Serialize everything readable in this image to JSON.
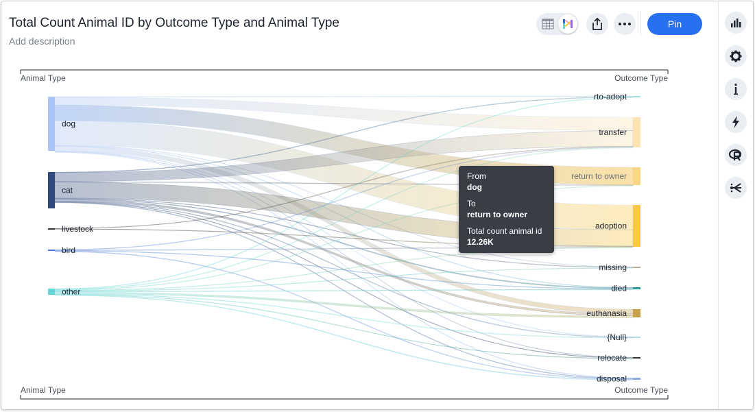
{
  "header": {
    "title": "Total Count Animal ID by Outcome Type and Animal Type",
    "description_placeholder": "Add description",
    "pin_label": "Pin"
  },
  "colors": {
    "accent": "#2770ef",
    "dog": "#a9c4f5",
    "cat": "#2f4a7d",
    "livestock": "#333333",
    "bird": "#4a78d6",
    "other": "#5fd6d4",
    "rto_adopt": "#9fe0dd",
    "transfer": "#fbe3b2",
    "return_to_owner": "#f8d683",
    "adoption": "#f8c844",
    "missing": "#b9b19a",
    "died": "#2a9d97",
    "euthanasia": "#c9a04a",
    "null": "#b8dce6",
    "relocate": "#333333",
    "disposal": "#8aa8df"
  },
  "toolbar_icons": [
    "table-icon",
    "chart-icon",
    "share-icon",
    "more-icon"
  ],
  "sidebar_icons": [
    "chart-type-icon",
    "settings-icon",
    "info-icon",
    "lightning-icon",
    "r-analysis-icon",
    "spotter-icon"
  ],
  "chart_data": {
    "type": "sankey",
    "title": "Total Count Animal ID by Outcome Type and Animal Type",
    "left_axis_label": "Animal Type",
    "right_axis_label": "Outcome Type",
    "sources": [
      "dog",
      "cat",
      "livestock",
      "bird",
      "other"
    ],
    "targets": [
      "rto-adopt",
      "transfer",
      "return to owner",
      "adoption",
      "missing",
      "died",
      "euthanasia",
      "{Null}",
      "relocate",
      "disposal"
    ],
    "source_totals": [
      42.0,
      28.5,
      0.3,
      0.6,
      4.8
    ],
    "target_totals": [
      0.6,
      13.5,
      12.3,
      32.0,
      0.3,
      1.1,
      6.1,
      0.8,
      0.3,
      0.7
    ],
    "links": [
      {
        "from": "dog",
        "to": "rto-adopt",
        "value": 0.3
      },
      {
        "from": "dog",
        "to": "transfer",
        "value": 6.0
      },
      {
        "from": "dog",
        "to": "return to owner",
        "value": 12.26
      },
      {
        "from": "dog",
        "to": "adoption",
        "value": 19.0
      },
      {
        "from": "dog",
        "to": "missing",
        "value": 0.1
      },
      {
        "from": "dog",
        "to": "died",
        "value": 0.3
      },
      {
        "from": "dog",
        "to": "euthanasia",
        "value": 3.5
      },
      {
        "from": "dog",
        "to": "{Null}",
        "value": 0.2
      },
      {
        "from": "dog",
        "to": "relocate",
        "value": 0.05
      },
      {
        "from": "dog",
        "to": "disposal",
        "value": 0.2
      },
      {
        "from": "cat",
        "to": "rto-adopt",
        "value": 0.2
      },
      {
        "from": "cat",
        "to": "transfer",
        "value": 7.0
      },
      {
        "from": "cat",
        "to": "return to owner",
        "value": 0.1
      },
      {
        "from": "cat",
        "to": "adoption",
        "value": 12.5
      },
      {
        "from": "cat",
        "to": "missing",
        "value": 0.1
      },
      {
        "from": "cat",
        "to": "died",
        "value": 0.5
      },
      {
        "from": "cat",
        "to": "euthanasia",
        "value": 1.5
      },
      {
        "from": "cat",
        "to": "{Null}",
        "value": 0.2
      },
      {
        "from": "cat",
        "to": "relocate",
        "value": 0.05
      },
      {
        "from": "cat",
        "to": "disposal",
        "value": 0.2
      },
      {
        "from": "livestock",
        "to": "adoption",
        "value": 0.1
      },
      {
        "from": "livestock",
        "to": "transfer",
        "value": 0.1
      },
      {
        "from": "bird",
        "to": "adoption",
        "value": 0.2
      },
      {
        "from": "bird",
        "to": "transfer",
        "value": 0.2
      },
      {
        "from": "bird",
        "to": "died",
        "value": 0.05
      },
      {
        "from": "bird",
        "to": "disposal",
        "value": 0.05
      },
      {
        "from": "other",
        "to": "rto-adopt",
        "value": 0.05
      },
      {
        "from": "other",
        "to": "transfer",
        "value": 0.3
      },
      {
        "from": "other",
        "to": "return to owner",
        "value": 0.05
      },
      {
        "from": "other",
        "to": "adoption",
        "value": 0.2
      },
      {
        "from": "other",
        "to": "died",
        "value": 0.3
      },
      {
        "from": "other",
        "to": "euthanasia",
        "value": 1.5
      },
      {
        "from": "other",
        "to": "{Null}",
        "value": 0.2
      },
      {
        "from": "other",
        "to": "relocate",
        "value": 0.05
      },
      {
        "from": "other",
        "to": "disposal",
        "value": 0.3
      },
      {
        "from": "other",
        "to": "missing",
        "value": 0.05
      }
    ],
    "highlighted_link": {
      "from": "dog",
      "to": "return to owner"
    }
  },
  "tooltip": {
    "from_label": "From",
    "from_value": "dog",
    "to_label": "To",
    "to_value": "return to owner",
    "measure_label": "Total count animal id",
    "measure_value": "12.26K"
  }
}
